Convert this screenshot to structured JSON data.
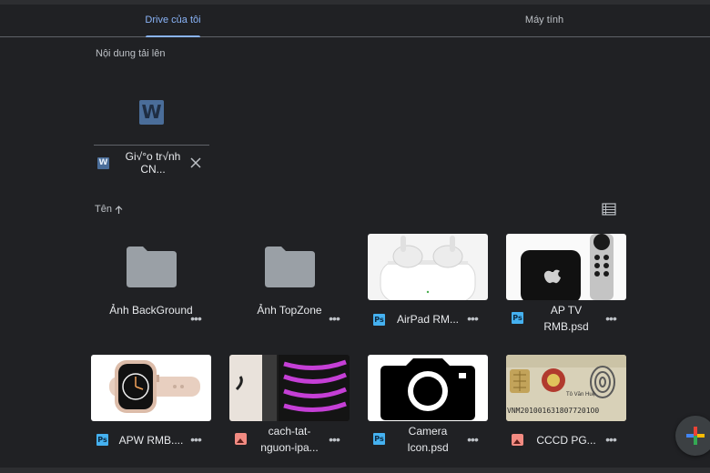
{
  "tabs": [
    {
      "label": "Drive của tôi",
      "active": true
    },
    {
      "label": "Máy tính",
      "active": false
    }
  ],
  "upload": {
    "section_label": "Nội dung tải lên",
    "file_name": "Gi√°o tr√­nh CN...",
    "badge": "W",
    "close_icon": "close-icon"
  },
  "list": {
    "sort_label": "Tên",
    "sort_icon": "arrow-up-icon",
    "view_icon": "list-view-icon"
  },
  "items": [
    {
      "type": "folder",
      "name": "Ảnh BackGround"
    },
    {
      "type": "folder",
      "name": "Ảnh TopZone"
    },
    {
      "type": "psd",
      "name": "AirPad RM..."
    },
    {
      "type": "psd",
      "name": "AP TV RMB.psd"
    },
    {
      "type": "psd",
      "name": "APW RMB...."
    },
    {
      "type": "image",
      "name": "cach-tat-nguon-ipa..."
    },
    {
      "type": "psd",
      "name": "Camera Icon.psd"
    },
    {
      "type": "image",
      "name": "CCCD PG..."
    }
  ],
  "file_badge": "Ps",
  "more_label": "•••",
  "thumb_text": {
    "cccd_name": "Tô Văn Huệ",
    "cccd_mrz": "VNM2010016318077201O0"
  },
  "fab": {
    "icon": "plus-icon"
  },
  "colors": {
    "accent": "#8ab4f8",
    "background": "#202124",
    "ps_badge": "#45b1f0",
    "image_badge": "#f28b82",
    "word_badge": "#4a6d99"
  }
}
